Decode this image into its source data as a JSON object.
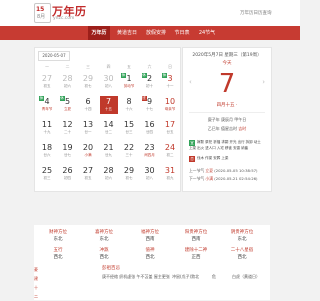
{
  "header": {
    "site_title": "万年历",
    "site_sub": "ynzc.com",
    "logo_num": "15",
    "logo_month": "8月",
    "top_link": "万年历日历查询"
  },
  "nav": {
    "items": [
      "万年历",
      "黄道吉日",
      "放假安排",
      "节日表",
      "24节气"
    ]
  },
  "calendar": {
    "date_select": "2020-05-07",
    "weekdays": [
      "一",
      "二",
      "三",
      "四",
      "五",
      "六",
      "日"
    ],
    "rows": [
      [
        {
          "n": "27",
          "s": "初五",
          "dim": true
        },
        {
          "n": "28",
          "s": "初六",
          "dim": true
        },
        {
          "n": "29",
          "s": "初七",
          "dim": true
        },
        {
          "n": "30",
          "s": "初八",
          "dim": true
        },
        {
          "n": "1",
          "s": "劳动节",
          "tag": "休",
          "fest": true
        },
        {
          "n": "2",
          "s": "初十",
          "tag": "休"
        },
        {
          "n": "3",
          "s": "十一",
          "tag": "休",
          "wkend": true
        }
      ],
      [
        {
          "n": "4",
          "s": "青年节",
          "tag": "休",
          "fest": true
        },
        {
          "n": "5",
          "s": "立夏",
          "tag": "休",
          "fest": true
        },
        {
          "n": "6",
          "s": "十四"
        },
        {
          "n": "7",
          "s": "十五",
          "sel": true
        },
        {
          "n": "8",
          "s": "十六"
        },
        {
          "n": "9",
          "s": "十七",
          "tag": "班"
        },
        {
          "n": "10",
          "s": "母亲节",
          "fest": true,
          "wkend": true
        }
      ],
      [
        {
          "n": "11",
          "s": "十九"
        },
        {
          "n": "12",
          "s": "二十"
        },
        {
          "n": "13",
          "s": "廿一"
        },
        {
          "n": "14",
          "s": "廿二"
        },
        {
          "n": "15",
          "s": "廿三"
        },
        {
          "n": "16",
          "s": "廿四"
        },
        {
          "n": "17",
          "s": "廿五",
          "wkend": true
        }
      ],
      [
        {
          "n": "18",
          "s": "廿六"
        },
        {
          "n": "19",
          "s": "廿七"
        },
        {
          "n": "20",
          "s": "小满",
          "fest": true
        },
        {
          "n": "21",
          "s": "廿九"
        },
        {
          "n": "22",
          "s": "三十"
        },
        {
          "n": "23",
          "s": "闰四月",
          "fest": true
        },
        {
          "n": "24",
          "s": "初二",
          "wkend": true
        }
      ],
      [
        {
          "n": "25",
          "s": "初三"
        },
        {
          "n": "26",
          "s": "初四"
        },
        {
          "n": "27",
          "s": "初五"
        },
        {
          "n": "28",
          "s": "初六"
        },
        {
          "n": "29",
          "s": "初七"
        },
        {
          "n": "30",
          "s": "初八"
        },
        {
          "n": "31",
          "s": "初九",
          "wkend": true
        }
      ]
    ]
  },
  "detail": {
    "title": "2020年5月7日 星期三（第19周）",
    "today": "今天",
    "big_day": "7",
    "lunar": "四月十五 ·",
    "ganzhi": "庚子年 庚辰月 甲午日",
    "star_prefix": "乙巳年 值星吉时",
    "star_tag": "吉时",
    "yi_label": "宜",
    "yi_text": "嫁娶 祭祀 祈福 求嗣 开光 出行 拆卸 动土 上梁 出火 进人口 入宅 移徙 安香 纳畜",
    "ji_label": "忌",
    "ji_text": "伐木 作梁 安葬 上梁",
    "term_prev_label": "上一节气",
    "term_prev_name": "立夏",
    "term_prev_date": "(2020-05-05 10:38:57)",
    "term_next_label": "下一节气",
    "term_next_name": "小满",
    "term_next_date": "(2020-05-21 02:54:26)"
  },
  "info_grid": {
    "r1": [
      {
        "h": "财神方位",
        "v": "东北"
      },
      {
        "h": "喜神方位",
        "v": "东北"
      },
      {
        "h": "福神方位",
        "v": "西南"
      },
      {
        "h": "阳贵神方位",
        "v": "西南"
      },
      {
        "h": "阴贵神方位",
        "v": "东北"
      }
    ],
    "r2": [
      {
        "h": "五行",
        "v": "西北"
      },
      {
        "h": "冲煞",
        "v": "西北"
      },
      {
        "h": "值神",
        "v": "西北"
      },
      {
        "h": "建除十二神",
        "v": "正西"
      },
      {
        "h": "二十八星宿",
        "v": "西北"
      }
    ],
    "left": [
      "菱",
      "建",
      "十",
      "二"
    ],
    "wuxing_title": "彭祖百忌",
    "wuxing_text": "庚不经络 织机虚张 午不苫盖 屋主更张",
    "extra_a": "冲鼠(戊子)煞北",
    "extra_b": "危",
    "extra_c": "白虎（黄道日）"
  },
  "colors": {
    "accent": "#c73b32",
    "rest": "#33a35a",
    "work": "#c0392b"
  }
}
